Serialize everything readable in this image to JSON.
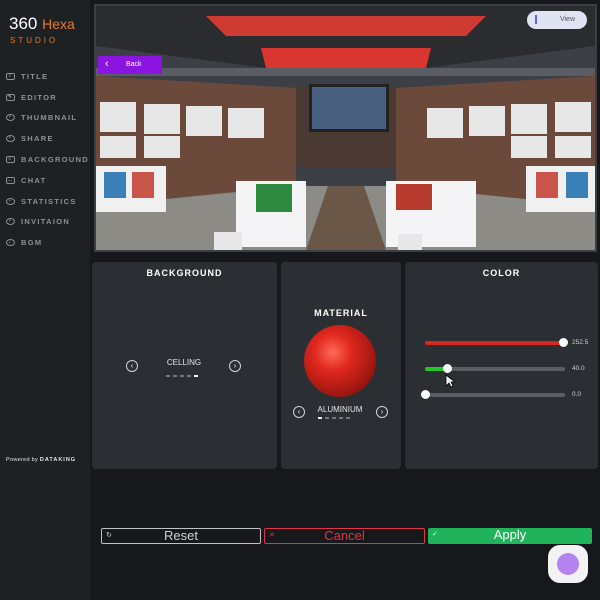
{
  "brand": {
    "line1": "360",
    "line1b": "Hexa",
    "line2": "STUDIO"
  },
  "menu": [
    {
      "label": "TITLE",
      "icon": "title-icon"
    },
    {
      "label": "EDITOR",
      "icon": "editor-icon"
    },
    {
      "label": "THUMBNAIL",
      "icon": "thumbnail-icon"
    },
    {
      "label": "SHARE",
      "icon": "share-icon"
    },
    {
      "label": "BACKGROUND",
      "icon": "sliders-icon"
    },
    {
      "label": "CHAT",
      "icon": "chat-icon"
    },
    {
      "label": "STATISTICS",
      "icon": "statistics-icon"
    },
    {
      "label": "INVITAION",
      "icon": "invitation-icon"
    },
    {
      "label": "BGM",
      "icon": "music-icon"
    }
  ],
  "powered": {
    "prefix": "Powered by",
    "brand": "DATAKING"
  },
  "viewport": {
    "view_label": "View",
    "back_label": "Back"
  },
  "background_panel": {
    "title": "BACKGROUND",
    "option": "CELLING",
    "dots_active": 5,
    "dots_total": 5
  },
  "material_panel": {
    "title": "MATERIAL",
    "option": "ALUMINIUM",
    "dots_active": 1,
    "dots_total": 5,
    "sphere_color": "#d9261c"
  },
  "color_panel": {
    "title": "COLOR",
    "sliders": [
      {
        "name": "red",
        "value": "252.5",
        "fraction": 0.99,
        "color": "#d9261c"
      },
      {
        "name": "green",
        "value": "40.0",
        "fraction": 0.16,
        "color": "#22c42a"
      },
      {
        "name": "blue",
        "value": "0.0",
        "fraction": 0.0,
        "color": "#3b6fe0"
      }
    ]
  },
  "actions": {
    "reset": "Reset",
    "cancel": "Cancel",
    "apply": "Apply"
  }
}
